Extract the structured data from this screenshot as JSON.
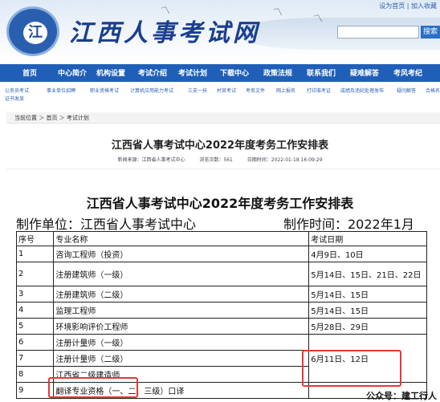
{
  "header": {
    "site_title": "江西人事考试网",
    "logo_text": "江",
    "top_links": "设为首页 | 加入收藏",
    "search_button": "搜索"
  },
  "nav": {
    "items": [
      "首页",
      "中心简介",
      "机构设置",
      "考试介绍",
      "考试计划",
      "下载中心",
      "政策法规",
      "联系我们",
      "疑难解答",
      "考风考纪"
    ]
  },
  "subnav": {
    "items": [
      "公务员考试",
      "事业单位招聘",
      "职业资格考试",
      "计算机应用能力考试",
      "三支一扶",
      "村官考试",
      "考务文件",
      "网上报名",
      "打印准考证",
      "成绩及违纪处理发布",
      "疑问解答",
      "合格名录",
      "证书发放"
    ]
  },
  "breadcrumb": {
    "text": "当前位置 ＞ 首页 ＞ 考试计划"
  },
  "article": {
    "title": "江西省人事考试中心2022年度考务工作安排表",
    "source": "新闻来源：江西省人事考试中心",
    "views": "浏览次数：561",
    "date": "日期时间：2022-01-18 16:09:29"
  },
  "doc": {
    "title": "江西省人事考试中心2022年度考务工作安排表",
    "org": "制作单位：江西省人事考试中心",
    "made_time": "制作时间：2022年1月"
  },
  "table": {
    "headers": [
      "序号",
      "专业名称",
      "考试日期"
    ],
    "rows": [
      [
        "1",
        "咨询工程师（投资）",
        "4月9日、10日"
      ],
      [
        "2",
        "注册建筑师（一级）",
        "5月14日、15日、21日、22日"
      ],
      [
        "3",
        "注册建筑师（二级）",
        "5月14日、15日"
      ],
      [
        "4",
        "监理工程师",
        "5月14日、15日"
      ],
      [
        "5",
        "环境影响评价工程师",
        "5月28日、29日"
      ],
      [
        "6",
        "注册计量师（一级）",
        ""
      ],
      [
        "7",
        "注册计量师（二级）",
        "6月11日、12日"
      ],
      [
        "8",
        "江西省二级建造师",
        ""
      ],
      [
        "9",
        "翻译专业资格（一、二、三级）口译",
        ""
      ]
    ]
  },
  "watermark": "公众号：建工行人"
}
